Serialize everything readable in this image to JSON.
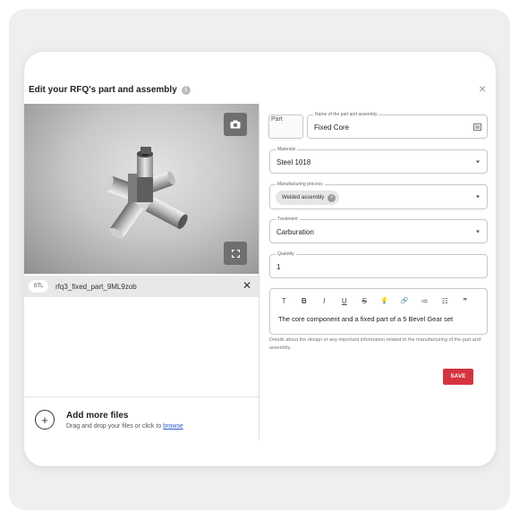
{
  "dialog": {
    "title": "Edit your RFQ's part and assembly",
    "info_icon_glyph": "i",
    "close_glyph": "×"
  },
  "viewer": {
    "camera_icon": "camera-icon",
    "fullscreen_icon": "fullscreen-icon"
  },
  "file": {
    "badge": "STL",
    "name": "rfq3_fixed_part_9ML9zob",
    "remove_glyph": "✕"
  },
  "add_files": {
    "plus_glyph": "+",
    "title": "Add more files",
    "subtitle": "Drag and drop your files or click to ",
    "browse_link": "browse"
  },
  "form": {
    "thumbnail_alt": "Part",
    "name_label": "Name of the part and assembly",
    "name_value": "Fixed Core",
    "materials_label": "Materials",
    "materials_value": "Steel 1018",
    "process_label": "Manufacturing process",
    "process_chip": "Welded assembly",
    "treatment_label": "Treatment",
    "treatment_value": "Carburation",
    "quantity_label": "Quantity",
    "quantity_value": "1",
    "description_text": "The core component and a fixed part of a 5 Bevel Gear set",
    "helper_text": "Details about the design or any important information related to the manufacturing of the part and assembly.",
    "save_label": "SAVE"
  },
  "toolbar": [
    "T",
    "B",
    "I",
    "U",
    "S",
    "💡",
    "🔗",
    "≔",
    "☷",
    "❞"
  ],
  "colors": {
    "accent": "#d4343f",
    "link": "#2b57c6"
  }
}
